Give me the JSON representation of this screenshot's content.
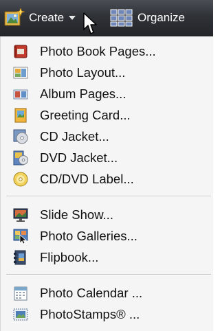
{
  "toolbar": {
    "create": {
      "label": "Create",
      "icon": "create-sparkle-icon"
    },
    "organize": {
      "label": "Organize",
      "icon": "grid-icon"
    }
  },
  "menu": {
    "groups": [
      {
        "items": [
          {
            "label": "Photo Book Pages...",
            "icon": "photo-book-icon"
          },
          {
            "label": "Photo Layout...",
            "icon": "photo-layout-icon"
          },
          {
            "label": "Album Pages...",
            "icon": "album-pages-icon"
          },
          {
            "label": "Greeting Card...",
            "icon": "greeting-card-icon"
          },
          {
            "label": "CD Jacket...",
            "icon": "cd-jacket-icon"
          },
          {
            "label": "DVD Jacket...",
            "icon": "dvd-jacket-icon"
          },
          {
            "label": "CD/DVD Label...",
            "icon": "cd-label-icon"
          }
        ]
      },
      {
        "items": [
          {
            "label": "Slide Show...",
            "icon": "slide-show-icon"
          },
          {
            "label": "Photo Galleries...",
            "icon": "photo-galleries-icon"
          },
          {
            "label": "Flipbook...",
            "icon": "flipbook-icon"
          }
        ]
      },
      {
        "items": [
          {
            "label": "Photo Calendar ...",
            "icon": "calendar-icon"
          },
          {
            "label": "PhotoStamps® ...",
            "icon": "photostamps-icon"
          }
        ]
      }
    ]
  }
}
